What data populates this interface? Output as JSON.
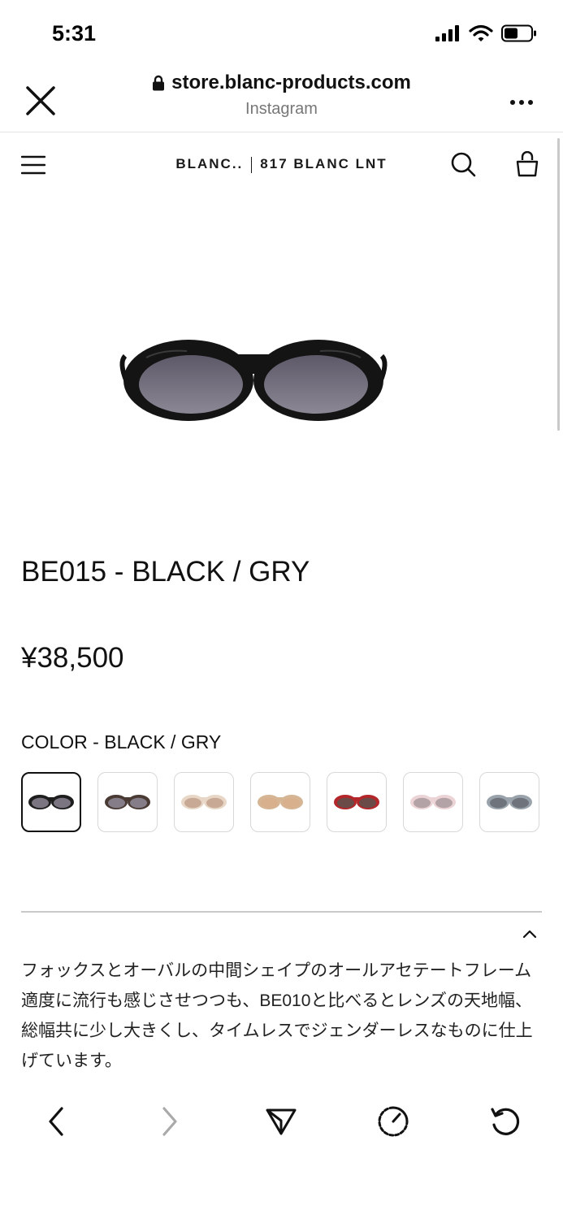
{
  "status_bar": {
    "time": "5:31"
  },
  "browser": {
    "url": "store.blanc-products.com",
    "source": "Instagram"
  },
  "site": {
    "brand_left": "BLANC..",
    "brand_right": "817 BLANC LNT"
  },
  "product": {
    "title": "BE015 - BLACK / GRY",
    "price": "¥38,500",
    "color_label": "COLOR - BLACK / GRY",
    "description": "フォックスとオーバルの中間シェイプのオールアセテートフレーム\n適度に流行も感じさせつつも、BE010と比べるとレンズの天地幅、総幅共に少し大きくし、タイムレスでジェンダーレスなものに仕上げています。"
  },
  "swatch_colors": [
    {
      "frame": "#1e1e1e",
      "lens": "#7a7580"
    },
    {
      "frame": "#4a3a34",
      "lens": "#857e88"
    },
    {
      "frame": "#e8d7c6",
      "lens": "#c7a995"
    },
    {
      "frame": "#d6b595",
      "lens": "#d9b08d"
    },
    {
      "frame": "#b3262a",
      "lens": "#6a4b48"
    },
    {
      "frame": "#ecd4d6",
      "lens": "#b3a2a6"
    },
    {
      "frame": "#9aa3ab",
      "lens": "#6f747c"
    }
  ],
  "icons": {
    "status": [
      "signal-icon",
      "wifi-icon",
      "battery-icon"
    ],
    "header": [
      "close-icon",
      "lock-icon",
      "more-icon"
    ],
    "nav": [
      "menu-icon",
      "search-icon",
      "bag-icon"
    ],
    "toolbar": [
      "back-icon",
      "forward-icon",
      "share-icon",
      "speed-icon",
      "refresh-icon"
    ]
  },
  "colors": {
    "text": "#111111",
    "muted": "#777777",
    "divider": "#c9c9c9"
  }
}
